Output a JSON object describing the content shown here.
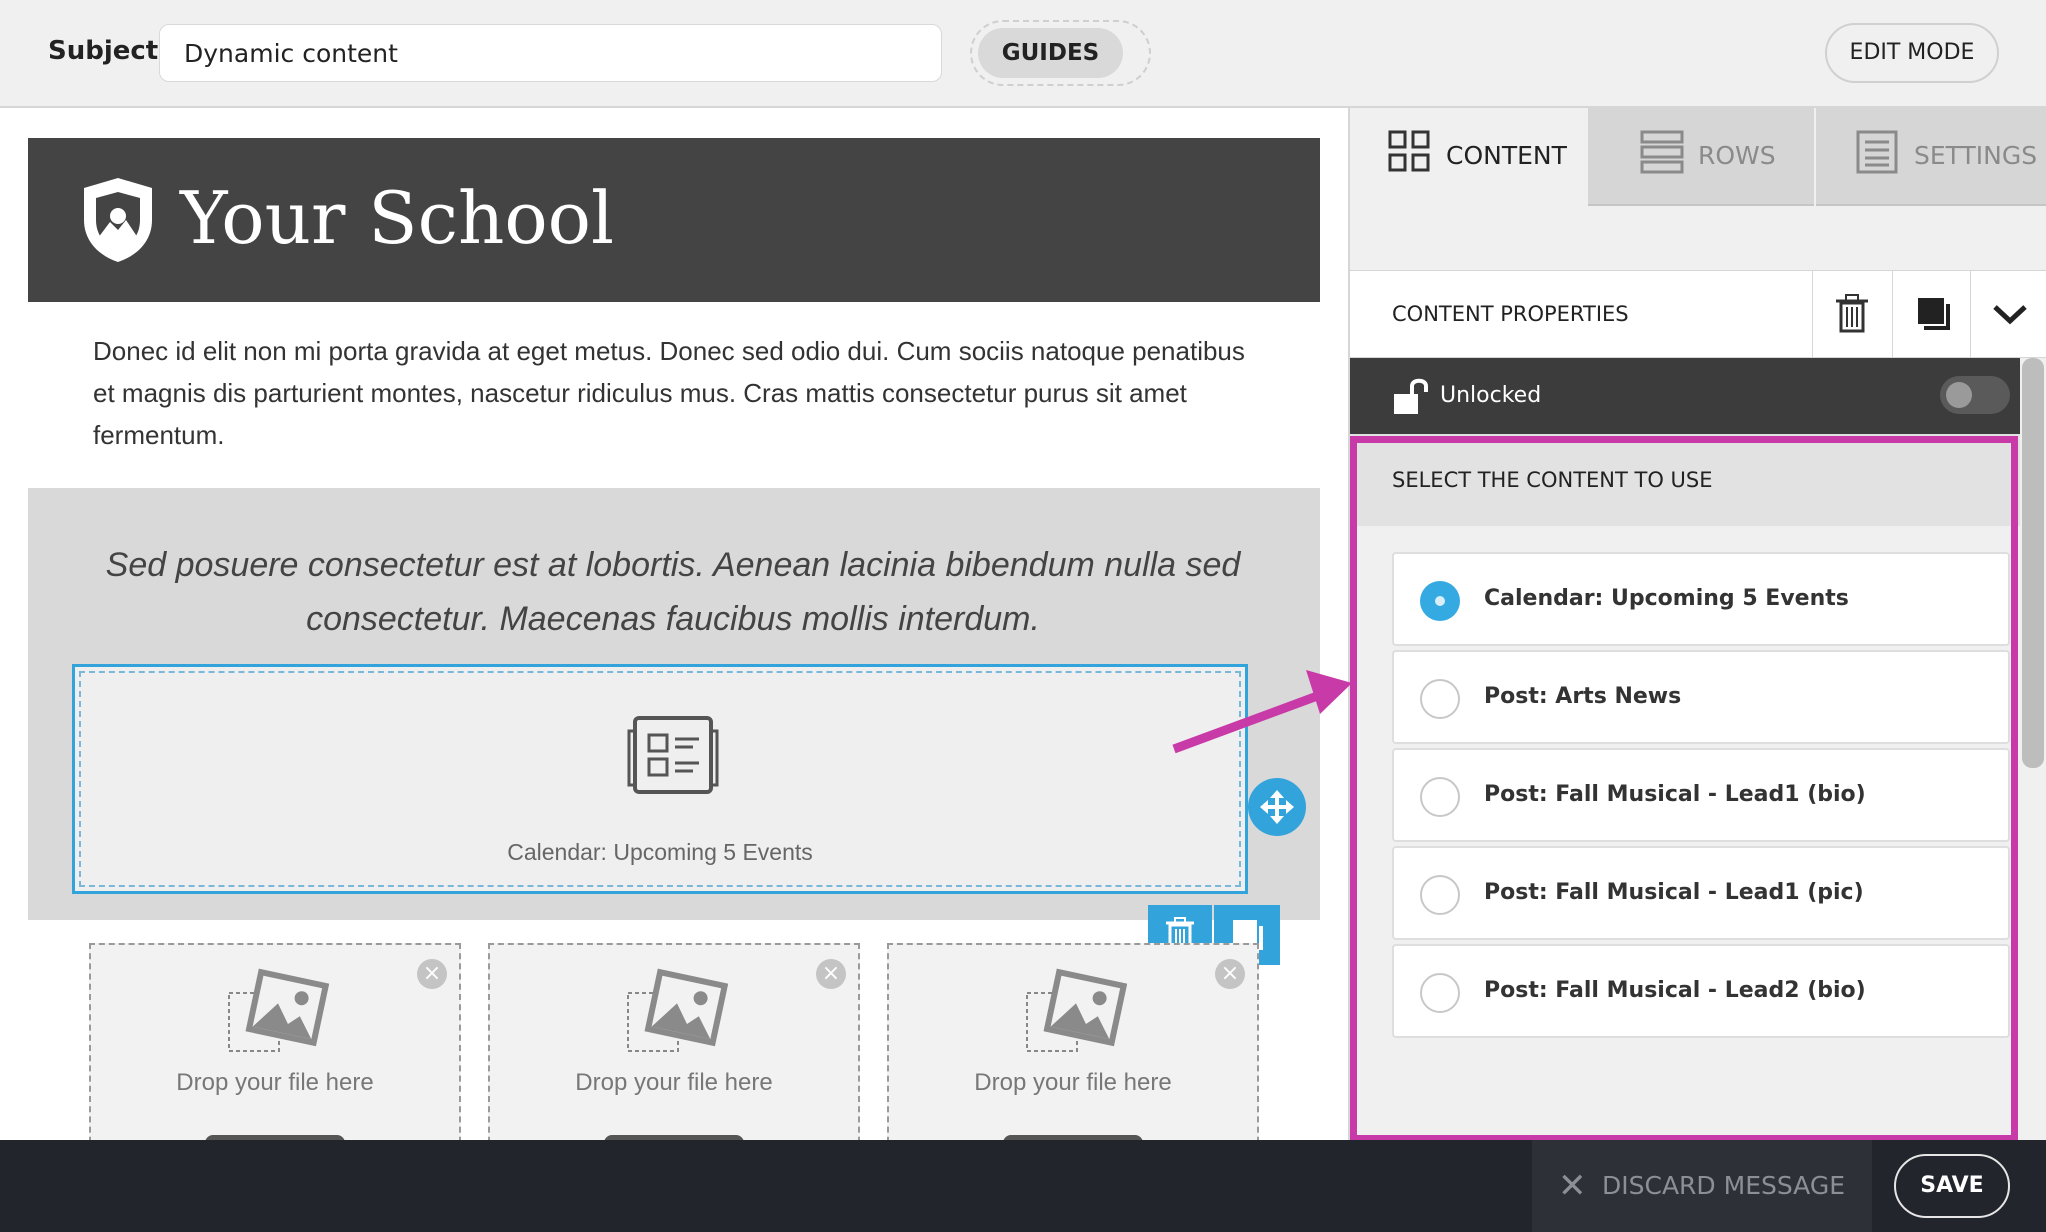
{
  "topbar": {
    "subject_label": "Subject",
    "subject_value": "Dynamic content",
    "guides_label": "GUIDES",
    "edit_mode_label": "EDIT MODE"
  },
  "canvas": {
    "school_name": "Your School",
    "paragraph": "Donec id elit non mi porta gravida at eget metus. Donec sed odio dui. Cum sociis natoque penatibus et magnis dis parturient montes, nascetur ridiculus mus. Cras mattis consectetur purus sit amet fermentum.",
    "quote": "Sed posuere consectetur est at lobortis. Aenean lacinia bibendum nulla sed consectetur. Maecenas faucibus mollis interdum.",
    "dynamic_block_label": "Calendar: Upcoming 5 Events",
    "drop_zones": [
      {
        "text": "Drop your file here"
      },
      {
        "text": "Drop your file here"
      },
      {
        "text": "Drop your file here"
      }
    ]
  },
  "panel": {
    "tabs": [
      {
        "label": "CONTENT",
        "active": true,
        "icon": "grid-icon"
      },
      {
        "label": "ROWS",
        "active": false,
        "icon": "rows-icon"
      },
      {
        "label": "SETTINGS",
        "active": false,
        "icon": "settings-list-icon"
      }
    ],
    "properties_title": "CONTENT PROPERTIES",
    "lock_label": "Unlocked",
    "select_header": "SELECT THE CONTENT TO USE",
    "options": [
      {
        "label": "Calendar: Upcoming 5 Events",
        "selected": true
      },
      {
        "label": "Post: Arts News",
        "selected": false
      },
      {
        "label": "Post: Fall Musical - Lead1 (bio)",
        "selected": false
      },
      {
        "label": "Post: Fall Musical - Lead1 (pic)",
        "selected": false
      },
      {
        "label": "Post: Fall Musical - Lead2 (bio)",
        "selected": false
      }
    ]
  },
  "bottombar": {
    "discard_label": "DISCARD MESSAGE",
    "save_label": "SAVE"
  },
  "colors": {
    "accent": "#33a3dc",
    "highlight": "#c83aa8",
    "header_band": "#444444",
    "bottom_bar": "#23252d"
  }
}
